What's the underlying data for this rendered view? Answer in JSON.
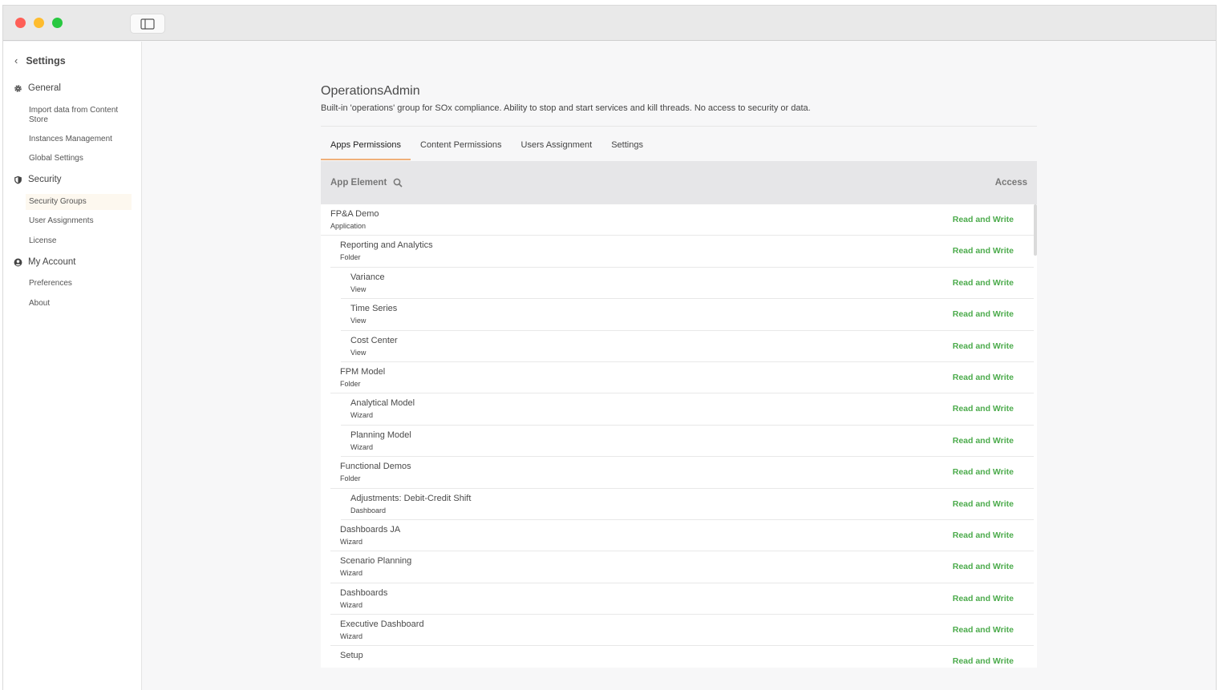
{
  "sidebar": {
    "back_title": "Settings",
    "sections": [
      {
        "label": "General",
        "icon": "gear-icon"
      },
      {
        "label": "Security",
        "icon": "shield-icon"
      },
      {
        "label": "My Account",
        "icon": "user-circle-icon"
      }
    ],
    "items": [
      "Import data from Content Store",
      "Instances Management",
      "Global Settings",
      "Security Groups",
      "User Assignments",
      "License",
      "Preferences",
      "About"
    ],
    "active_item": "Security Groups"
  },
  "main": {
    "title": "OperationsAdmin",
    "description": "Built-in 'operations' group for SOx compliance. Ability to stop and start services and kill threads. No access to security or data.",
    "tabs": [
      "Apps Permissions",
      "Content Permissions",
      "Users Assignment",
      "Settings"
    ],
    "active_tab": "Apps Permissions"
  },
  "table": {
    "col_element": "App Element",
    "col_access": "Access",
    "rows": [
      {
        "name": "FP&A Demo",
        "type": "Application",
        "access": "Read and Write",
        "level": 0
      },
      {
        "name": "Reporting and Analytics",
        "type": "Folder",
        "access": "Read and Write",
        "level": 1
      },
      {
        "name": "Variance",
        "type": "View",
        "access": "Read and Write",
        "level": 2
      },
      {
        "name": "Time Series",
        "type": "View",
        "access": "Read and Write",
        "level": 2
      },
      {
        "name": "Cost Center",
        "type": "View",
        "access": "Read and Write",
        "level": 2
      },
      {
        "name": "FPM Model",
        "type": "Folder",
        "access": "Read and Write",
        "level": 1
      },
      {
        "name": "Analytical Model",
        "type": "Wizard",
        "access": "Read and Write",
        "level": 2
      },
      {
        "name": "Planning Model",
        "type": "Wizard",
        "access": "Read and Write",
        "level": 2
      },
      {
        "name": "Functional Demos",
        "type": "Folder",
        "access": "Read and Write",
        "level": 1
      },
      {
        "name": "Adjustments: Debit-Credit Shift",
        "type": "Dashboard",
        "access": "Read and Write",
        "level": 2
      },
      {
        "name": "Dashboards JA",
        "type": "Wizard",
        "access": "Read and Write",
        "level": 1
      },
      {
        "name": "Scenario Planning",
        "type": "Wizard",
        "access": "Read and Write",
        "level": 1
      },
      {
        "name": "Dashboards",
        "type": "Wizard",
        "access": "Read and Write",
        "level": 1
      },
      {
        "name": "Executive Dashboard",
        "type": "Wizard",
        "access": "Read and Write",
        "level": 1
      },
      {
        "name": "Setup",
        "type": "",
        "access": "Read and Write",
        "level": 1
      }
    ]
  },
  "colors": {
    "access_green": "#4cab4c",
    "active_tab_underline": "#f0b07a",
    "active_sidebar_bg": "#fdf8ef"
  }
}
